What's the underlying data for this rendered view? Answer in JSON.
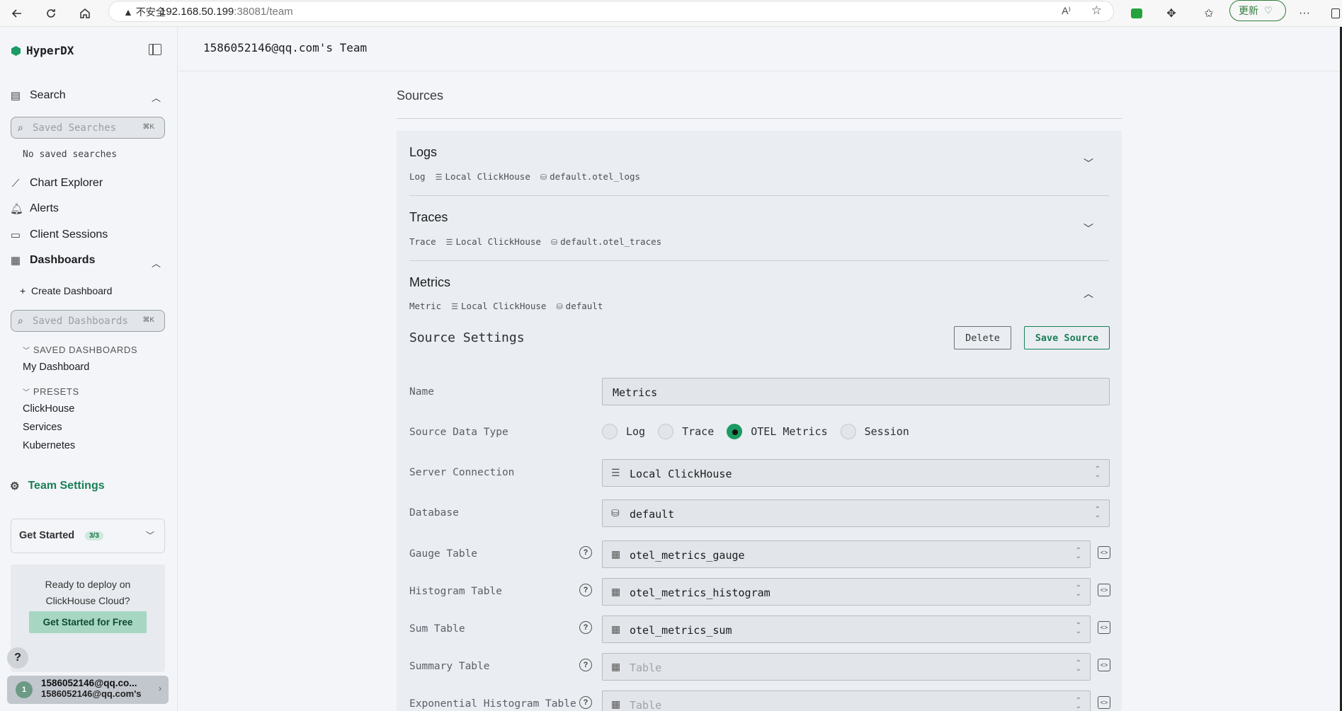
{
  "browser": {
    "warning": "不安全",
    "url_host": "192.168.50.199",
    "url_path": ":38081/team",
    "update_label": "更新"
  },
  "sidebar": {
    "brand": "HyperDX",
    "search_label": "Search",
    "saved_searches_placeholder": "Saved Searches",
    "kbd_hint": "⌘K",
    "no_saved_searches": "No saved searches",
    "chart_explorer": "Chart Explorer",
    "alerts": "Alerts",
    "client_sessions": "Client Sessions",
    "dashboards": "Dashboards",
    "create_dashboard": "Create Dashboard",
    "saved_dashboards_placeholder": "Saved Dashboards",
    "saved_dashboards_header": "SAVED DASHBOARDS",
    "saved_dashboards": [
      "My Dashboard"
    ],
    "presets_header": "PRESETS",
    "presets": [
      "ClickHouse",
      "Services",
      "Kubernetes"
    ],
    "team_settings": "Team Settings",
    "get_started": "Get Started",
    "get_started_badge": "3/3",
    "deploy_text_1": "Ready to deploy on",
    "deploy_text_2": "ClickHouse Cloud?",
    "deploy_button": "Get Started for Free",
    "help": "?",
    "user_avatar": "1",
    "user_email": "1586052146@qq.co...",
    "user_team": "1586052146@qq.com's"
  },
  "header": {
    "title": "1586052146@qq.com's Team"
  },
  "sources": {
    "title": "Sources",
    "items": [
      {
        "name": "Logs",
        "kind": "Log",
        "connection": "Local ClickHouse",
        "table": "default.otel_logs",
        "expanded": false
      },
      {
        "name": "Traces",
        "kind": "Trace",
        "connection": "Local ClickHouse",
        "table": "default.otel_traces",
        "expanded": false
      },
      {
        "name": "Metrics",
        "kind": "Metric",
        "connection": "Local ClickHouse",
        "table": "default",
        "expanded": true
      }
    ]
  },
  "settings": {
    "title": "Source Settings",
    "delete_label": "Delete",
    "save_label": "Save Source",
    "name_label": "Name",
    "name_value": "Metrics",
    "type_label": "Source Data Type",
    "type_options": [
      "Log",
      "Trace",
      "OTEL Metrics",
      "Session"
    ],
    "type_selected": "OTEL Metrics",
    "server_label": "Server Connection",
    "server_value": "Local ClickHouse",
    "database_label": "Database",
    "database_value": "default",
    "gauge_label": "Gauge Table",
    "gauge_value": "otel_metrics_gauge",
    "histogram_label": "Histogram Table",
    "histogram_value": "otel_metrics_histogram",
    "sum_label": "Sum Table",
    "sum_value": "otel_metrics_sum",
    "summary_label": "Summary Table",
    "summary_placeholder": "Table",
    "exp_label": "Exponential Histogram Table",
    "exp_placeholder": "Table"
  }
}
